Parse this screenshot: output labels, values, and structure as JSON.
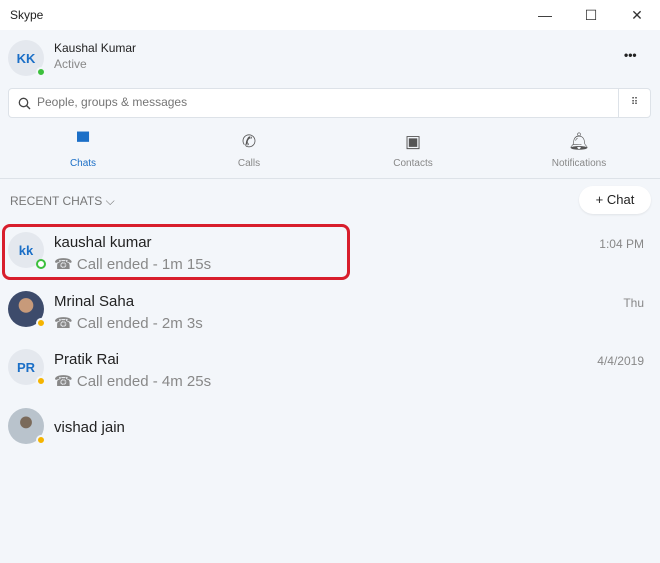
{
  "window": {
    "title": "Skype",
    "minimize": "—",
    "maximize": "☐",
    "close": "✕"
  },
  "profile": {
    "initials": "KK",
    "name": "Kaushal Kumar",
    "status": "Active",
    "more": "•••"
  },
  "search": {
    "placeholder": "People, groups & messages"
  },
  "tabs": [
    {
      "label": "Chats"
    },
    {
      "label": "Calls"
    },
    {
      "label": "Contacts"
    },
    {
      "label": "Notifications"
    }
  ],
  "recent": {
    "header": "RECENT CHATS",
    "new_chat": "+ Chat"
  },
  "chats": [
    {
      "initials": "kk",
      "name": "kaushal kumar",
      "sub": "Call ended - 1m 15s",
      "time": "1:04 PM"
    },
    {
      "name": "Mrinal Saha",
      "sub": "Call ended - 2m 3s",
      "time": "Thu"
    },
    {
      "initials": "PR",
      "name": "Pratik Rai",
      "sub": "Call ended - 4m 25s",
      "time": "4/4/2019"
    },
    {
      "name": "vishad jain"
    }
  ]
}
